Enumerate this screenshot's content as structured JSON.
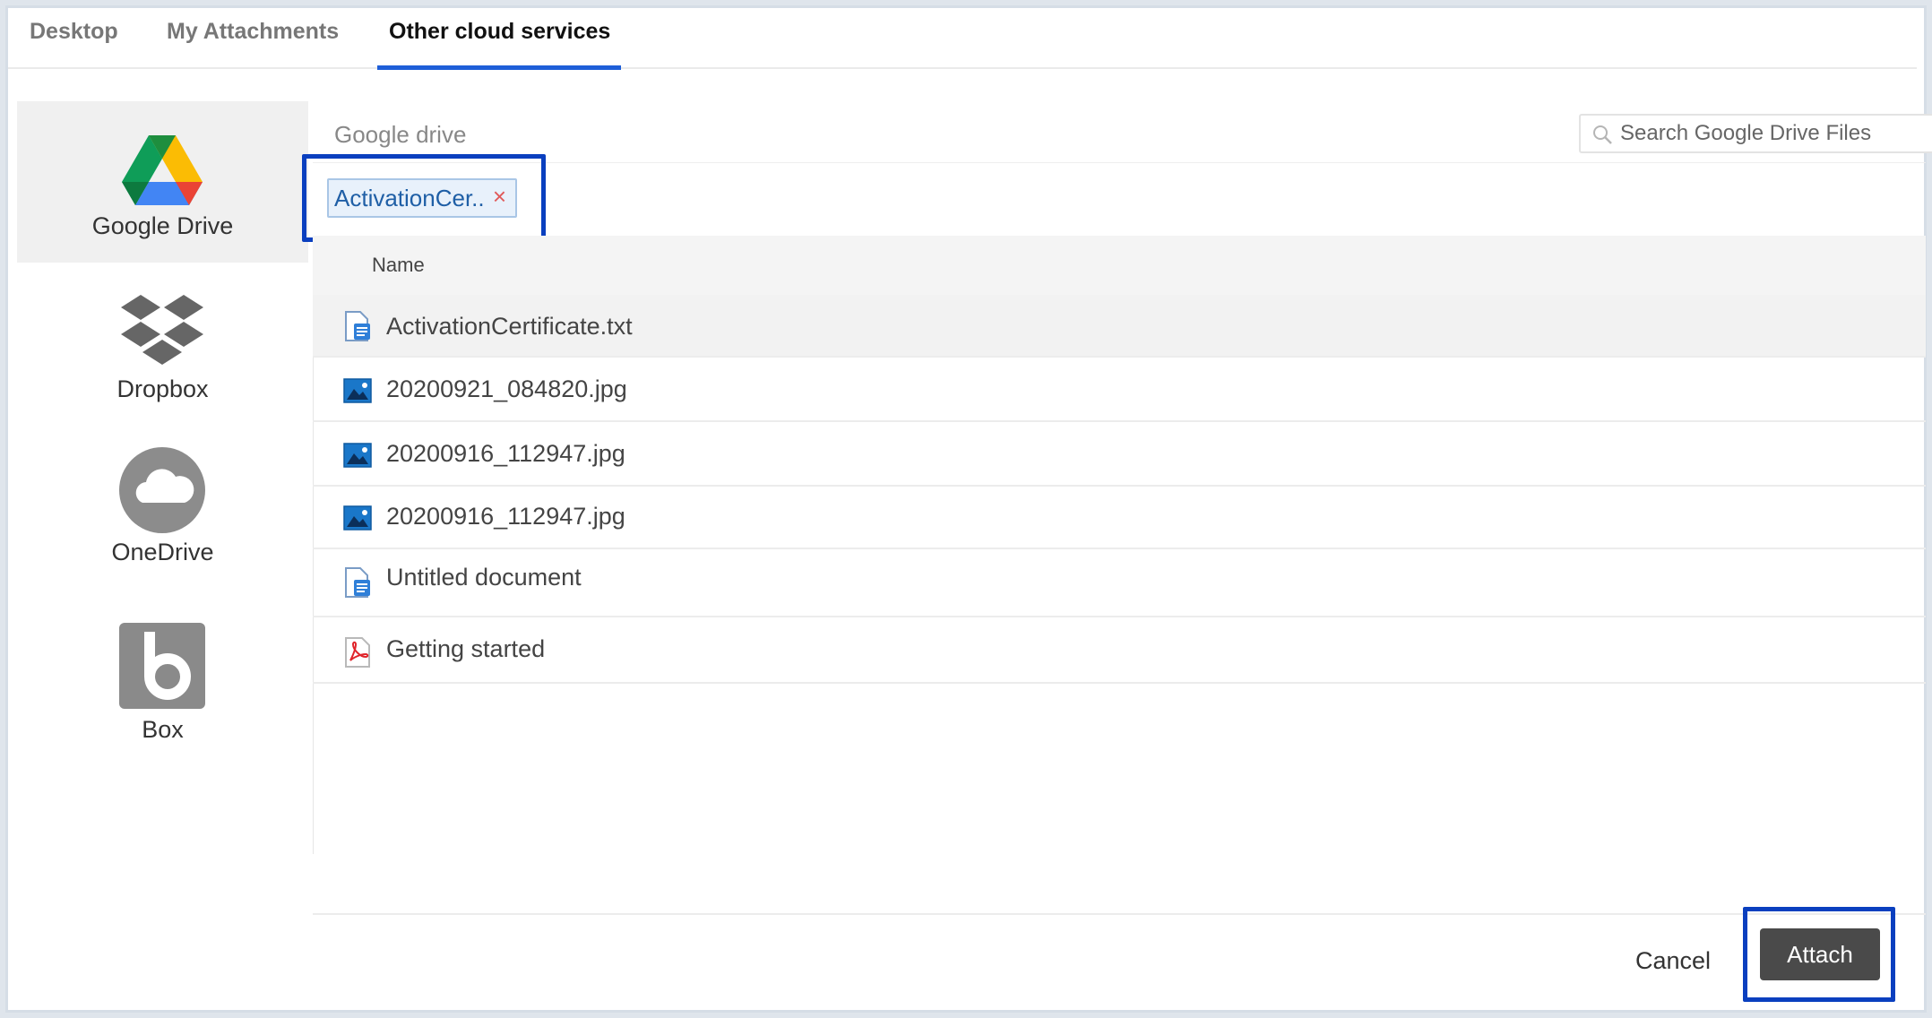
{
  "tabs": [
    {
      "label": "Desktop",
      "active": false
    },
    {
      "label": "My Attachments",
      "active": false
    },
    {
      "label": "Other cloud services",
      "active": true
    }
  ],
  "providers": [
    {
      "label": "Google Drive",
      "icon": "google-drive-icon",
      "active": true
    },
    {
      "label": "Dropbox",
      "icon": "dropbox-icon",
      "active": false
    },
    {
      "label": "OneDrive",
      "icon": "onedrive-icon",
      "active": false
    },
    {
      "label": "Box",
      "icon": "box-icon",
      "active": false
    }
  ],
  "main": {
    "location_title": "Google drive",
    "search_placeholder": "Search Google Drive Files",
    "selected_chip": {
      "label": "ActivationCer..",
      "remove_symbol": "×"
    },
    "column_header": "Name",
    "files": [
      {
        "name": "ActivationCertificate.txt",
        "icon": "text-document-icon",
        "selected": true
      },
      {
        "name": "20200921_084820.jpg",
        "icon": "image-file-icon",
        "selected": false
      },
      {
        "name": "20200916_112947.jpg",
        "icon": "image-file-icon",
        "selected": false
      },
      {
        "name": "20200916_112947.jpg",
        "icon": "image-file-icon",
        "selected": false
      },
      {
        "name": "Untitled document",
        "icon": "text-document-icon",
        "selected": false
      },
      {
        "name": "Getting started",
        "icon": "pdf-file-icon",
        "selected": false
      }
    ]
  },
  "footer": {
    "cancel_label": "Cancel",
    "attach_label": "Attach"
  },
  "colors": {
    "accent": "#1e5ed8",
    "highlight_border": "#0a3fbf",
    "attach_button": "#4a4a4a"
  }
}
